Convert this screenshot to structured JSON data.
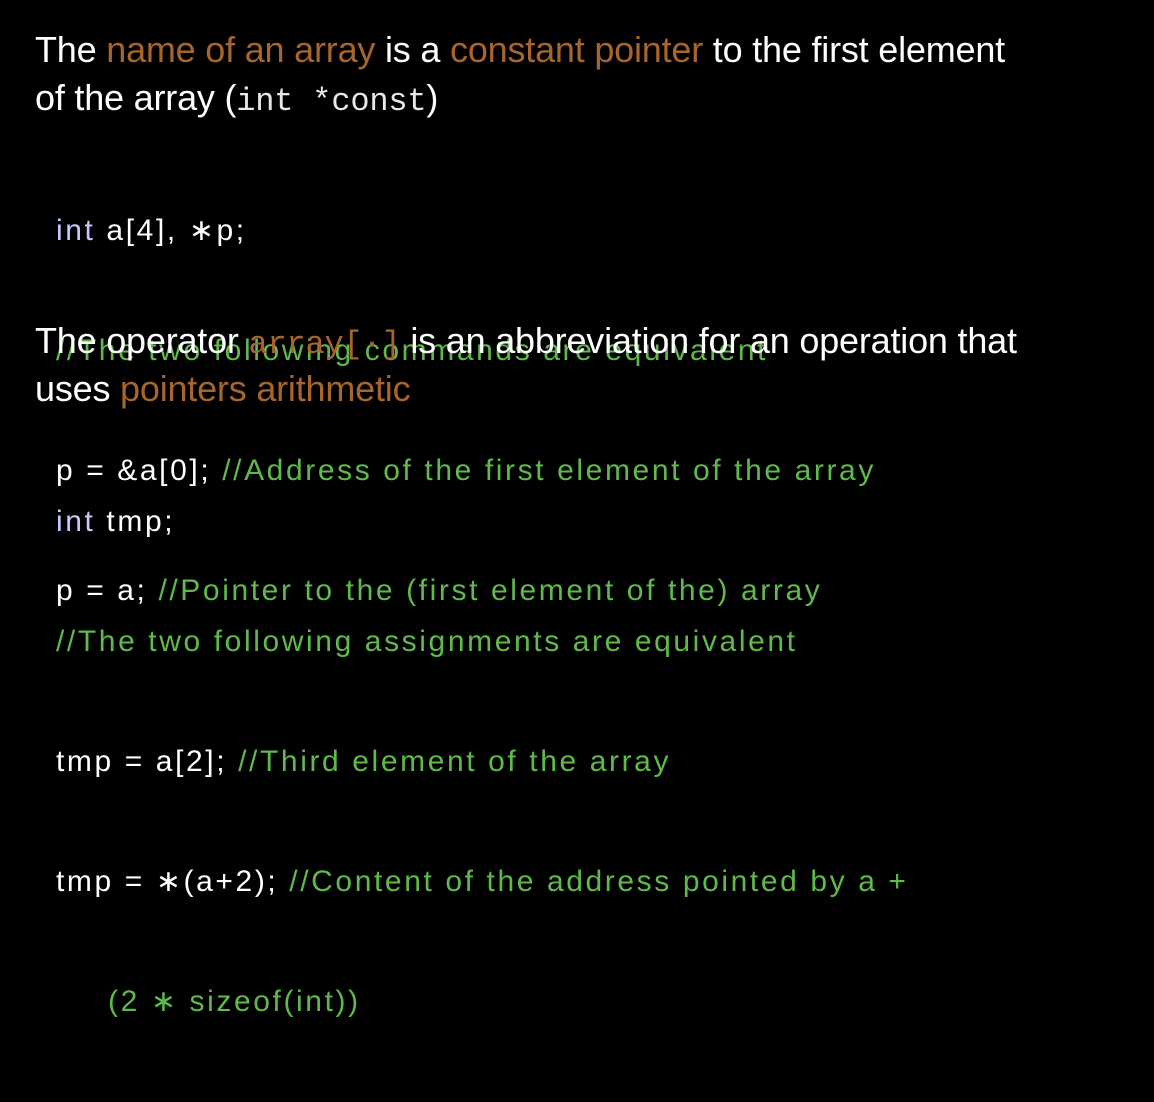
{
  "colors": {
    "background": "#000000",
    "text": "#ffffff",
    "highlight": "#a8652b",
    "keyword": "#c8c8ff",
    "comment": "#5fba4b"
  },
  "section1": {
    "line1": {
      "t1": "The ",
      "h1": "name of an array",
      "t2": " is a ",
      "h2": "constant pointer",
      "t3": " to the first element"
    },
    "line2": {
      "t1": "of the array (",
      "code": "int *const",
      "t2": ")"
    },
    "code": {
      "l1_kw": "int",
      "l1_rest": " a[4], ∗p;",
      "l2_comment": "//The two following commands are equivalent",
      "l3_code": "p = &a[0]; ",
      "l3_comment": "//Address of the first element of the array",
      "l4_code": "p = a; ",
      "l4_comment": "//Pointer to the (first element of the) array"
    }
  },
  "section2": {
    "line1": {
      "t1": "The operator ",
      "code": "array[·]",
      "t2": " is an abbreviation for an operation that"
    },
    "line2": {
      "t1": "uses ",
      "h1": "pointers arithmetic"
    },
    "code": {
      "l1_kw": "int",
      "l1_rest": " tmp;",
      "l2_comment": "//The two following assignments are equivalent",
      "l3_code": "tmp = a[2]; ",
      "l3_comment": "//Third element of the array",
      "l4_code": "tmp = ∗(a+2); ",
      "l4_comment": "//Content of the address pointed by a +",
      "l5_comment": "(2 ∗ sizeof(int))"
    }
  }
}
